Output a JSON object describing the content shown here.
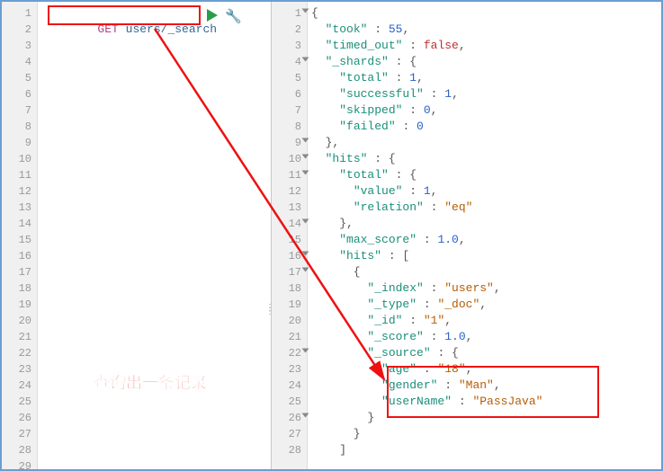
{
  "request": {
    "method": "GET",
    "path": "users/_search"
  },
  "left_line_count": 29,
  "annotation_text": "查询出一条记录",
  "response_lines": [
    {
      "n": 1,
      "fold": true,
      "tokens": [
        {
          "t": "{",
          "c": "j-punc"
        }
      ]
    },
    {
      "n": 2,
      "tokens": [
        {
          "t": "  "
        },
        {
          "t": "\"took\"",
          "c": "j-key"
        },
        {
          "t": " : ",
          "c": "j-punc"
        },
        {
          "t": "55",
          "c": "j-num"
        },
        {
          "t": ",",
          "c": "j-punc"
        }
      ]
    },
    {
      "n": 3,
      "tokens": [
        {
          "t": "  "
        },
        {
          "t": "\"timed_out\"",
          "c": "j-key"
        },
        {
          "t": " : ",
          "c": "j-punc"
        },
        {
          "t": "false",
          "c": "j-bool"
        },
        {
          "t": ",",
          "c": "j-punc"
        }
      ]
    },
    {
      "n": 4,
      "fold": true,
      "tokens": [
        {
          "t": "  "
        },
        {
          "t": "\"_shards\"",
          "c": "j-key"
        },
        {
          "t": " : {",
          "c": "j-punc"
        }
      ]
    },
    {
      "n": 5,
      "tokens": [
        {
          "t": "    "
        },
        {
          "t": "\"total\"",
          "c": "j-key"
        },
        {
          "t": " : ",
          "c": "j-punc"
        },
        {
          "t": "1",
          "c": "j-num"
        },
        {
          "t": ",",
          "c": "j-punc"
        }
      ]
    },
    {
      "n": 6,
      "tokens": [
        {
          "t": "    "
        },
        {
          "t": "\"successful\"",
          "c": "j-key"
        },
        {
          "t": " : ",
          "c": "j-punc"
        },
        {
          "t": "1",
          "c": "j-num"
        },
        {
          "t": ",",
          "c": "j-punc"
        }
      ]
    },
    {
      "n": 7,
      "tokens": [
        {
          "t": "    "
        },
        {
          "t": "\"skipped\"",
          "c": "j-key"
        },
        {
          "t": " : ",
          "c": "j-punc"
        },
        {
          "t": "0",
          "c": "j-num"
        },
        {
          "t": ",",
          "c": "j-punc"
        }
      ]
    },
    {
      "n": 8,
      "tokens": [
        {
          "t": "    "
        },
        {
          "t": "\"failed\"",
          "c": "j-key"
        },
        {
          "t": " : ",
          "c": "j-punc"
        },
        {
          "t": "0",
          "c": "j-num"
        }
      ]
    },
    {
      "n": 9,
      "fold": true,
      "tokens": [
        {
          "t": "  },",
          "c": "j-punc"
        }
      ]
    },
    {
      "n": 10,
      "fold": true,
      "tokens": [
        {
          "t": "  "
        },
        {
          "t": "\"hits\"",
          "c": "j-key"
        },
        {
          "t": " : {",
          "c": "j-punc"
        }
      ]
    },
    {
      "n": 11,
      "fold": true,
      "tokens": [
        {
          "t": "    "
        },
        {
          "t": "\"total\"",
          "c": "j-key"
        },
        {
          "t": " : {",
          "c": "j-punc"
        }
      ]
    },
    {
      "n": 12,
      "tokens": [
        {
          "t": "      "
        },
        {
          "t": "\"value\"",
          "c": "j-key"
        },
        {
          "t": " : ",
          "c": "j-punc"
        },
        {
          "t": "1",
          "c": "j-num"
        },
        {
          "t": ",",
          "c": "j-punc"
        }
      ]
    },
    {
      "n": 13,
      "tokens": [
        {
          "t": "      "
        },
        {
          "t": "\"relation\"",
          "c": "j-key"
        },
        {
          "t": " : ",
          "c": "j-punc"
        },
        {
          "t": "\"eq\"",
          "c": "j-str"
        }
      ]
    },
    {
      "n": 14,
      "fold": true,
      "tokens": [
        {
          "t": "    },",
          "c": "j-punc"
        }
      ]
    },
    {
      "n": 15,
      "tokens": [
        {
          "t": "    "
        },
        {
          "t": "\"max_score\"",
          "c": "j-key"
        },
        {
          "t": " : ",
          "c": "j-punc"
        },
        {
          "t": "1.0",
          "c": "j-num"
        },
        {
          "t": ",",
          "c": "j-punc"
        }
      ]
    },
    {
      "n": 16,
      "fold": true,
      "tokens": [
        {
          "t": "    "
        },
        {
          "t": "\"hits\"",
          "c": "j-key"
        },
        {
          "t": " : [",
          "c": "j-punc"
        }
      ]
    },
    {
      "n": 17,
      "fold": true,
      "tokens": [
        {
          "t": "      {",
          "c": "j-punc"
        }
      ]
    },
    {
      "n": 18,
      "tokens": [
        {
          "t": "        "
        },
        {
          "t": "\"_index\"",
          "c": "j-key"
        },
        {
          "t": " : ",
          "c": "j-punc"
        },
        {
          "t": "\"users\"",
          "c": "j-str"
        },
        {
          "t": ",",
          "c": "j-punc"
        }
      ]
    },
    {
      "n": 19,
      "tokens": [
        {
          "t": "        "
        },
        {
          "t": "\"_type\"",
          "c": "j-key"
        },
        {
          "t": " : ",
          "c": "j-punc"
        },
        {
          "t": "\"_doc\"",
          "c": "j-str"
        },
        {
          "t": ",",
          "c": "j-punc"
        }
      ]
    },
    {
      "n": 20,
      "tokens": [
        {
          "t": "        "
        },
        {
          "t": "\"_id\"",
          "c": "j-key"
        },
        {
          "t": " : ",
          "c": "j-punc"
        },
        {
          "t": "\"1\"",
          "c": "j-str"
        },
        {
          "t": ",",
          "c": "j-punc"
        }
      ]
    },
    {
      "n": 21,
      "tokens": [
        {
          "t": "        "
        },
        {
          "t": "\"_score\"",
          "c": "j-key"
        },
        {
          "t": " : ",
          "c": "j-punc"
        },
        {
          "t": "1.0",
          "c": "j-num"
        },
        {
          "t": ",",
          "c": "j-punc"
        }
      ]
    },
    {
      "n": 22,
      "fold": true,
      "tokens": [
        {
          "t": "        "
        },
        {
          "t": "\"_source\"",
          "c": "j-key"
        },
        {
          "t": " : {",
          "c": "j-punc"
        }
      ]
    },
    {
      "n": 23,
      "tokens": [
        {
          "t": "          "
        },
        {
          "t": "\"age\"",
          "c": "j-key"
        },
        {
          "t": " : ",
          "c": "j-punc"
        },
        {
          "t": "\"18\"",
          "c": "j-str"
        },
        {
          "t": ",",
          "c": "j-punc"
        }
      ]
    },
    {
      "n": 24,
      "tokens": [
        {
          "t": "          "
        },
        {
          "t": "\"gender\"",
          "c": "j-key"
        },
        {
          "t": " : ",
          "c": "j-punc"
        },
        {
          "t": "\"Man\"",
          "c": "j-str"
        },
        {
          "t": ",",
          "c": "j-punc"
        }
      ]
    },
    {
      "n": 25,
      "tokens": [
        {
          "t": "          "
        },
        {
          "t": "\"userName\"",
          "c": "j-key"
        },
        {
          "t": " : ",
          "c": "j-punc"
        },
        {
          "t": "\"PassJava\"",
          "c": "j-str"
        }
      ]
    },
    {
      "n": 26,
      "fold": true,
      "tokens": [
        {
          "t": "        }",
          "c": "j-punc"
        }
      ]
    },
    {
      "n": 27,
      "tokens": [
        {
          "t": "      }",
          "c": "j-punc"
        }
      ]
    },
    {
      "n": 28,
      "tokens": [
        {
          "t": "    ]",
          "c": "j-punc"
        }
      ]
    }
  ]
}
